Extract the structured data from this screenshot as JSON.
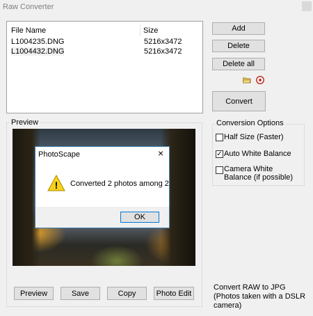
{
  "window": {
    "title": "Raw Converter",
    "close_glyph": ""
  },
  "file_list": {
    "headers": {
      "name": "File Name",
      "size": "Size"
    },
    "rows": [
      {
        "name": "L1004235.DNG",
        "size": "5216x3472"
      },
      {
        "name": "L1004432.DNG",
        "size": "5216x3472"
      }
    ]
  },
  "buttons": {
    "add": "Add",
    "delete": "Delete",
    "delete_all": "Delete all",
    "convert": "Convert",
    "preview": "Preview",
    "save": "Save",
    "copy": "Copy",
    "photo_edit": "Photo Edit"
  },
  "icons": {
    "open_folder": "folder-open-icon",
    "help": "help-icon"
  },
  "preview": {
    "label": "Preview"
  },
  "dialog": {
    "title": "PhotoScape",
    "close": "×",
    "message": "Converted 2 photos among 2",
    "ok": "OK",
    "warning_glyph": "!"
  },
  "options": {
    "label": "Conversion Options",
    "half_size": {
      "label": "Half Size (Faster)",
      "checked": false
    },
    "auto_wb": {
      "label": "Auto White Balance",
      "checked": true
    },
    "camera_wb": {
      "label": "Camera White Balance (if possible)",
      "checked": false
    }
  },
  "info_text": "Convert RAW to JPG (Photos taken with a DSLR camera)"
}
